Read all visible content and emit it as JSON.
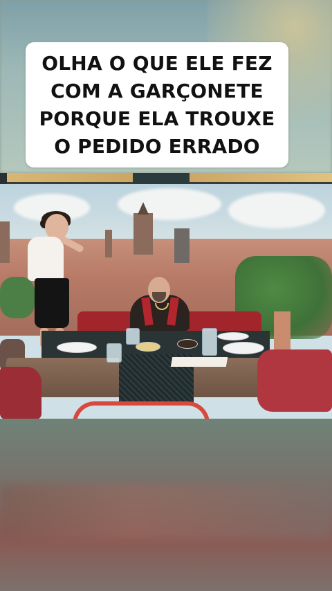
{
  "caption": {
    "lines": [
      "OLHA O QUE ELE FEZ",
      "COM A GARÇONETE",
      "PORQUE ELA TROUXE",
      "O PEDIDO ERRADO"
    ]
  },
  "colors": {
    "caption_bg": "#ffffff",
    "caption_text": "#111111",
    "booth": "#a3252c",
    "chair": "#d9473d"
  }
}
